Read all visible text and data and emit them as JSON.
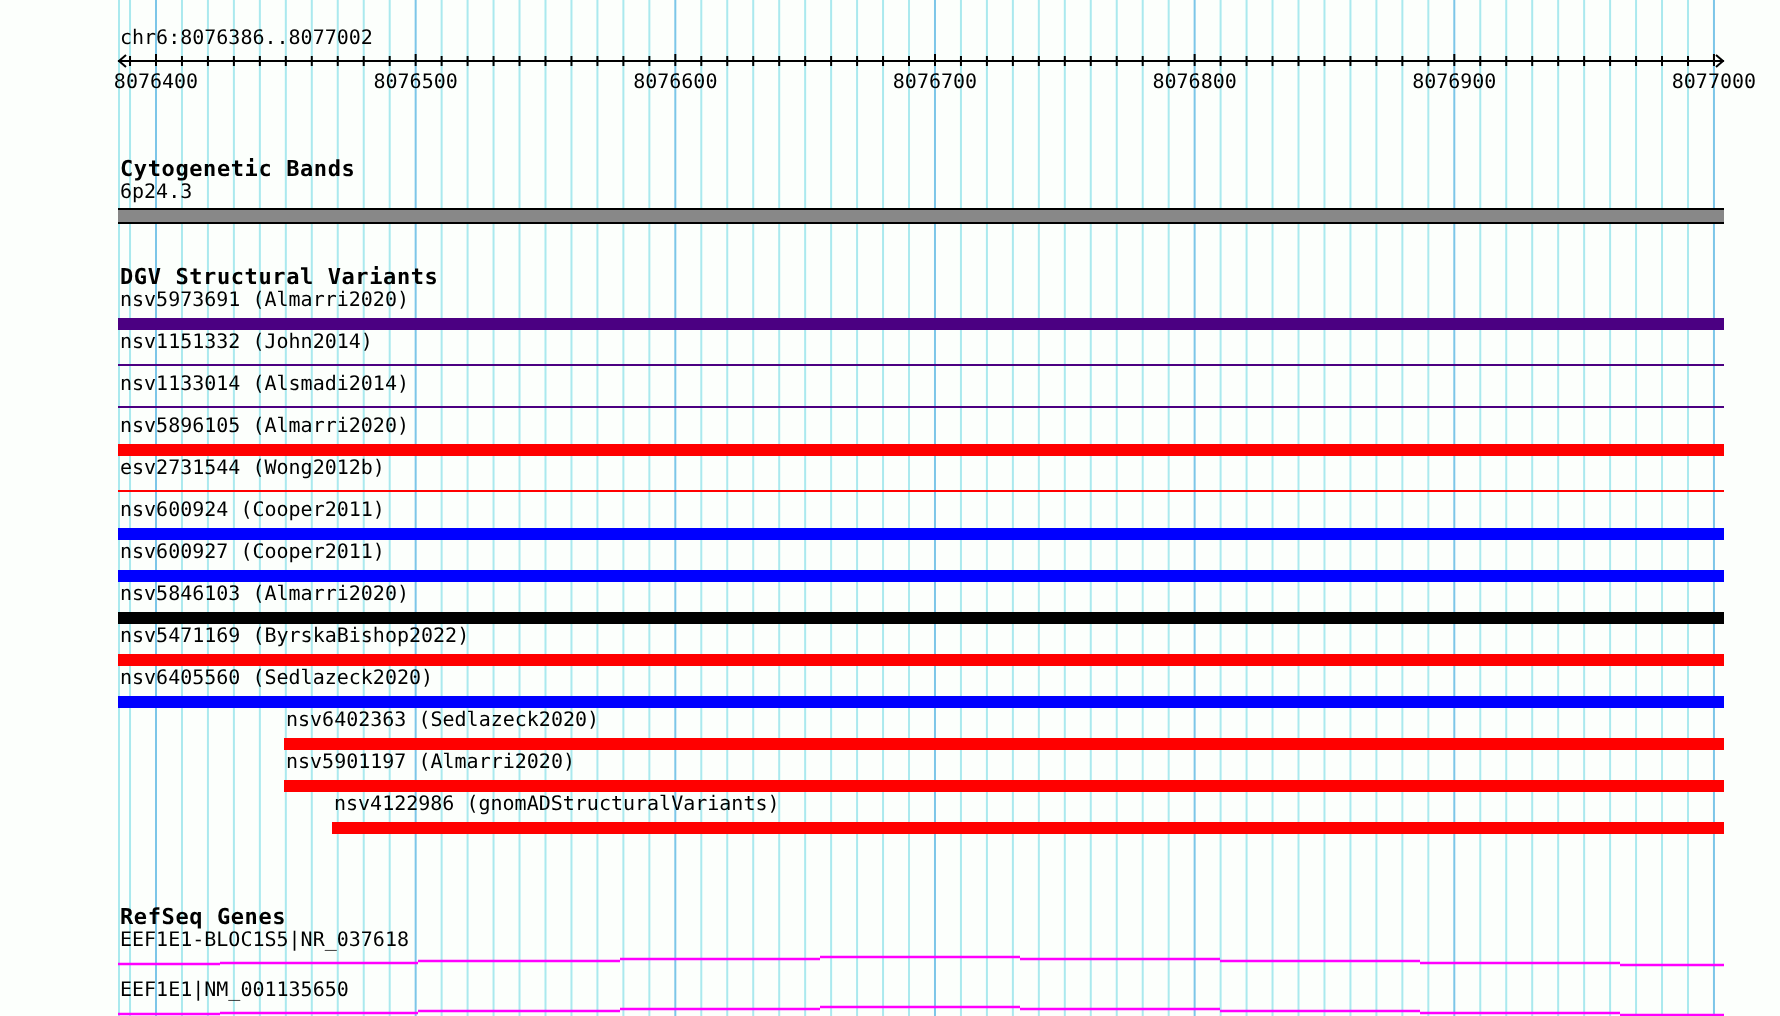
{
  "ruler": {
    "location": "chr6:8076386..8077002",
    "tick_labels": [
      "8076400",
      "8076500",
      "8076600",
      "8076700",
      "8076800",
      "8076900",
      "8077000"
    ]
  },
  "cytogenetic_bands": {
    "title": "Cytogenetic Bands",
    "band": "6p24.3"
  },
  "dgv_structural_variants": {
    "title": "DGV Structural Variants",
    "variants": [
      {
        "label": "nsv5973691 (Almarri2020)",
        "kind": "thick",
        "color": "#4b0082"
      },
      {
        "label": "nsv1151332 (John2014)",
        "kind": "thin",
        "color": "#4b0082"
      },
      {
        "label": "nsv1133014 (Alsmadi2014)",
        "kind": "thin",
        "color": "#4b0082"
      },
      {
        "label": "nsv5896105 (Almarri2020)",
        "kind": "thick",
        "color": "#ff0000"
      },
      {
        "label": "esv2731544 (Wong2012b)",
        "kind": "thin",
        "color": "#ff0000"
      },
      {
        "label": "nsv600924 (Cooper2011)",
        "kind": "thick",
        "color": "#0000ff"
      },
      {
        "label": "nsv600927 (Cooper2011)",
        "kind": "thick",
        "color": "#0000ff"
      },
      {
        "label": "nsv5846103 (Almarri2020)",
        "kind": "thick",
        "color": "#000000"
      },
      {
        "label": "nsv5471169 (ByrskaBishop2022)",
        "kind": "thick",
        "color": "#ff0000"
      },
      {
        "label": "nsv6405560 (Sedlazeck2020)",
        "kind": "thick",
        "color": "#0000ff"
      },
      {
        "label": "nsv6402363 (Sedlazeck2020)",
        "kind": "thick",
        "color": "#ff0000"
      },
      {
        "label": "nsv5901197 (Almarri2020)",
        "kind": "thick",
        "color": "#ff0000"
      },
      {
        "label": "nsv4122986 (gnomADStructuralVariants)",
        "kind": "thick",
        "color": "#ff0000"
      }
    ]
  },
  "refseq_genes": {
    "title": "RefSeq Genes",
    "genes": [
      {
        "label": "EEF1E1-BLOC1S5|NR_037618"
      },
      {
        "label": "EEF1E1|NM_001135650"
      }
    ]
  }
}
